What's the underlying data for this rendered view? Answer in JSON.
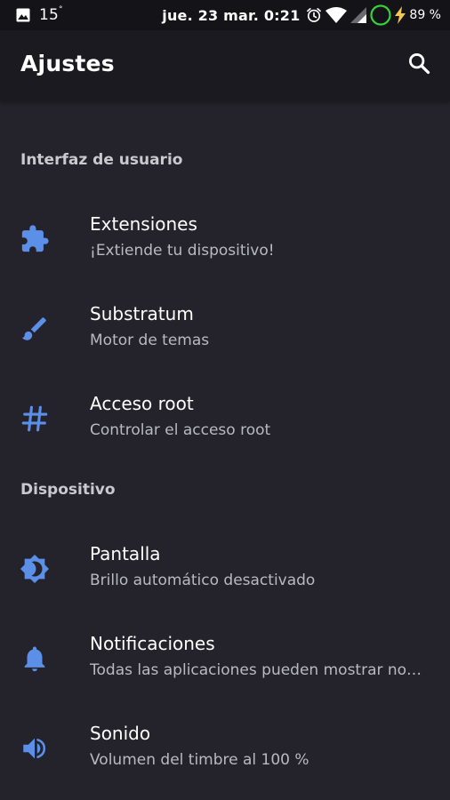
{
  "status_bar": {
    "temperature": "15",
    "temperature_unit": "°",
    "datetime": "jue. 23 mar. 0:21",
    "battery_percent": "89 %",
    "icons": [
      "image-icon",
      "alarm-icon",
      "wifi-icon",
      "cell-signal-icon",
      "circle-status-icon",
      "charging-bolt-icon"
    ],
    "colors": {
      "ring": "#37d13b",
      "bolt": "#f2c94c"
    }
  },
  "app_bar": {
    "title": "Ajustes",
    "search_icon": "search-icon"
  },
  "sections": [
    {
      "header": "Interfaz de usuario",
      "items": [
        {
          "title": "Extensiones",
          "summary": "¡Extiende tu dispositivo!",
          "icon": "puzzle-icon"
        },
        {
          "title": "Substratum",
          "summary": "Motor de temas",
          "icon": "brush-icon"
        },
        {
          "title": "Acceso root",
          "summary": "Controlar el acceso root",
          "icon": "hash-icon"
        }
      ]
    },
    {
      "header": "Dispositivo",
      "items": [
        {
          "title": "Pantalla",
          "summary": "Brillo automático desactivado",
          "icon": "brightness-icon"
        },
        {
          "title": "Notificaciones",
          "summary": "Todas las aplicaciones pueden mostrar no…",
          "icon": "bell-icon"
        },
        {
          "title": "Sonido",
          "summary": "Volumen del timbre al 100 %",
          "icon": "volume-icon"
        }
      ]
    }
  ],
  "theme": {
    "accent": "#5c8fe8",
    "background": "#24232b",
    "appbar_background": "#1b1a20",
    "statusbar_background": "#131318"
  }
}
